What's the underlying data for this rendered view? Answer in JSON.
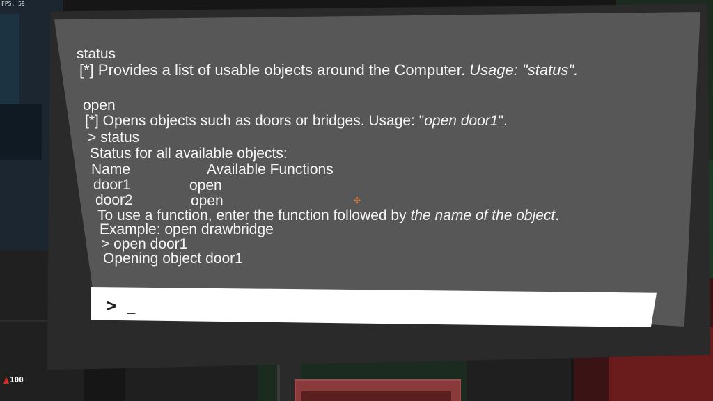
{
  "hud": {
    "fps": "FPS: 59",
    "health": "100"
  },
  "terminal": {
    "lines": [
      "status",
      "[*] Provides a list of usable objects around the Computer. ",
      "Usage: \"status\".",
      "open",
      "[*] Opens objects such as doors or bridges. Usage: \"",
      "open door1",
      "\".",
      "> status",
      "Status for all available objects:",
      "Name",
      "Available Functions",
      "door1",
      "open",
      "door2",
      "open",
      "To use a function, enter the function followed by ",
      "the name of the object",
      ".",
      "Example: open drawbridge",
      "> open door1",
      "Opening object door1"
    ],
    "prompt_symbol": ">",
    "cursor": "_"
  }
}
